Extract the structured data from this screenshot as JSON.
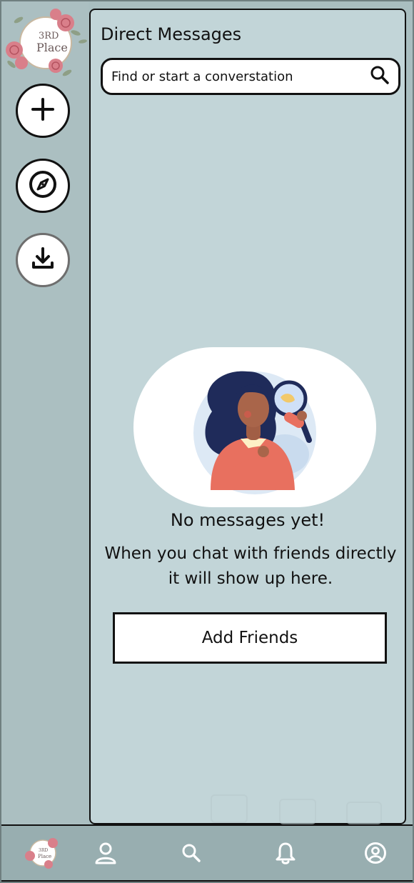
{
  "app": {
    "logo_text_line1": "3RD",
    "logo_text_line2": "Place"
  },
  "rail": {
    "buttons": [
      {
        "icon": "plus-icon"
      },
      {
        "icon": "compass-icon"
      },
      {
        "icon": "download-icon"
      }
    ]
  },
  "main": {
    "title": "Direct Messages",
    "search": {
      "placeholder": "Find or start a converstation",
      "value": ""
    },
    "empty_state": {
      "title": "No messages yet!",
      "description_line1": "When you chat with friends directly",
      "description_line2": "it will show up here.",
      "button_label": "Add Friends"
    }
  },
  "bottom_nav": {
    "items": [
      {
        "icon": "logo-icon"
      },
      {
        "icon": "person-icon"
      },
      {
        "icon": "search-icon"
      },
      {
        "icon": "bell-icon"
      },
      {
        "icon": "account-circle-icon"
      }
    ]
  },
  "colors": {
    "rail_bg": "#abbfc1",
    "panel_bg": "#c2d5d8",
    "nav_bg": "#98aeb0",
    "border": "#111111"
  }
}
